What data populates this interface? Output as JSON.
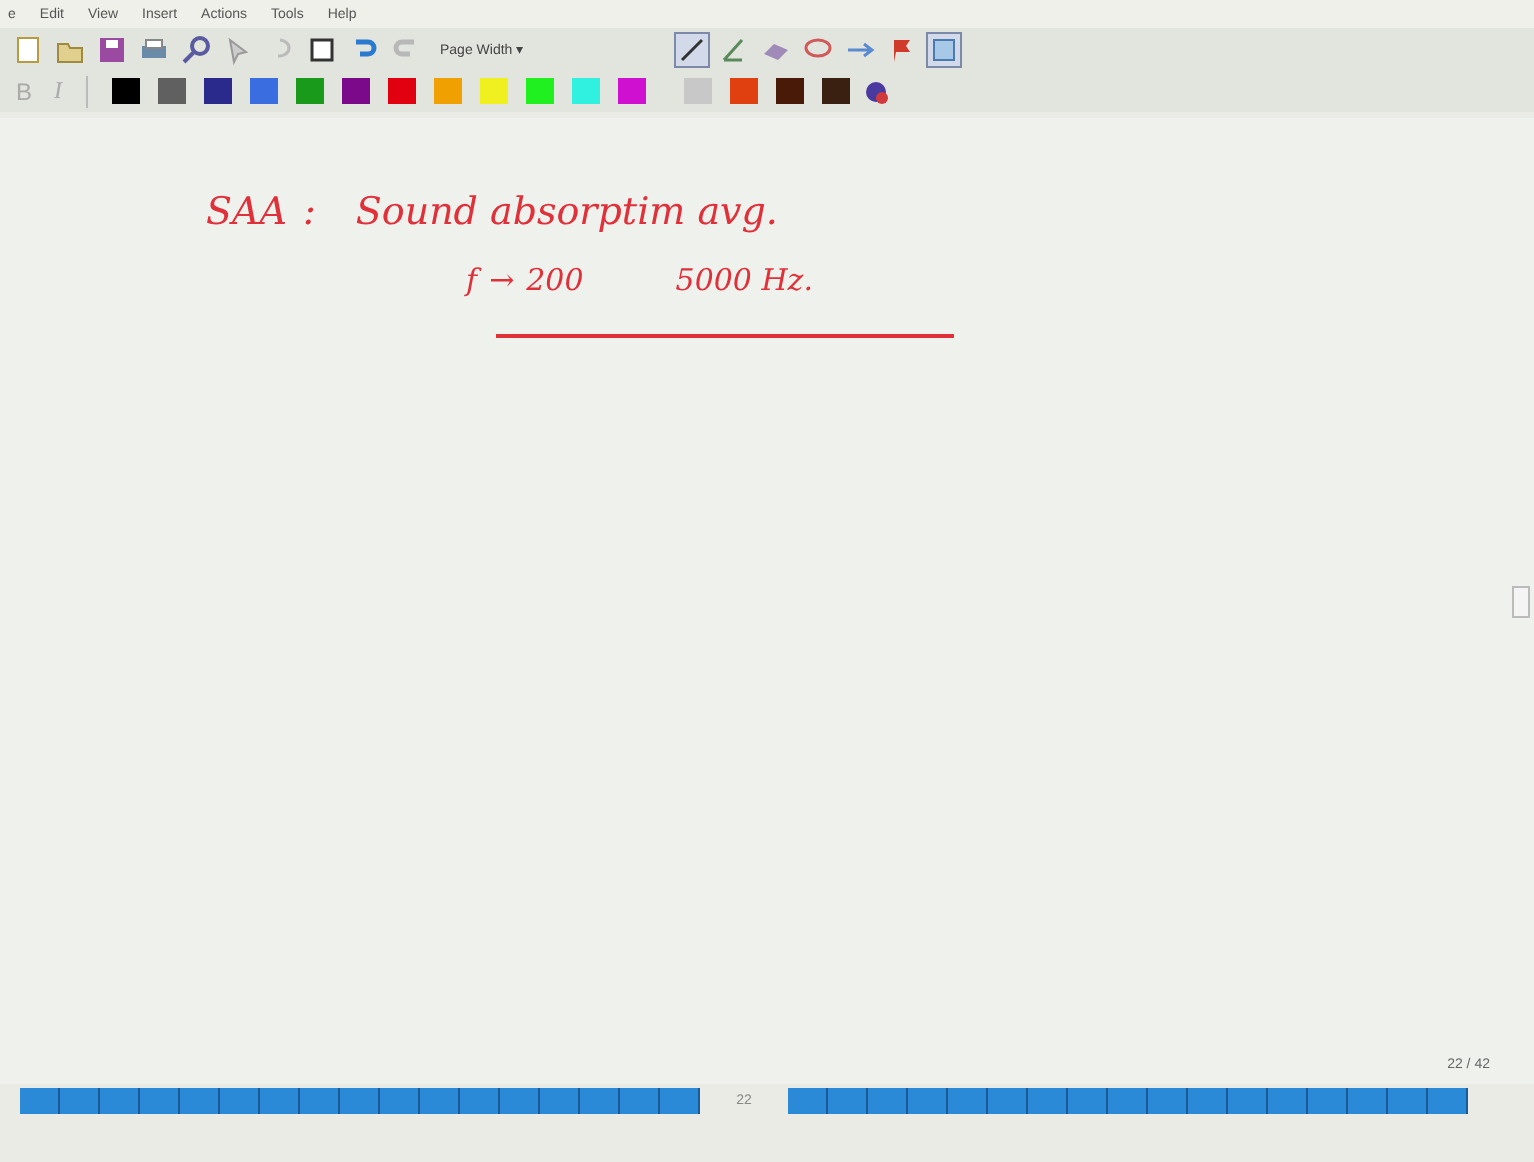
{
  "menu_bar": {
    "items": [
      "e",
      "Edit",
      "View",
      "Insert",
      "Actions",
      "Tools",
      "Help"
    ]
  },
  "toolbar": {
    "zoom_dropdown": {
      "value": "Page Width",
      "caret": "▾"
    },
    "pen_selected": true,
    "select_selected": true
  },
  "format_bar": {
    "bold_label": "B",
    "italic_label": "I",
    "colors": [
      {
        "color": "#000000",
        "selected": false
      },
      {
        "color": "#606060",
        "selected": false
      },
      {
        "color": "#2a2a8c",
        "selected": false
      },
      {
        "color": "#3a6ee0",
        "selected": false
      },
      {
        "color": "#1a9a1a",
        "selected": false
      },
      {
        "color": "#7a0a8a",
        "selected": false
      },
      {
        "color": "#e00010",
        "selected": false
      },
      {
        "color": "#f0a000",
        "selected": false
      },
      {
        "color": "#f0f020",
        "selected": false
      },
      {
        "color": "#20f020",
        "selected": false
      },
      {
        "color": "#30f0e0",
        "selected": false
      },
      {
        "color": "#d010d0",
        "selected": false
      },
      {
        "color": "#c8c8c8",
        "selected": false
      },
      {
        "color": "#e04010",
        "selected": false
      },
      {
        "color": "#4a1a08",
        "selected": false
      },
      {
        "color": "#3a2010",
        "selected": false
      }
    ]
  },
  "note": {
    "lines": [
      {
        "kind": "heading",
        "label": "SAA",
        "separator": ":",
        "text": "Sound absorptim avg."
      },
      {
        "kind": "formula",
        "left": "f",
        "arrow": "→",
        "from": "200",
        "to": "5000 Hz."
      }
    ],
    "underline": true
  },
  "page_counter": "22 / 42",
  "page_strip": {
    "current": "22"
  }
}
